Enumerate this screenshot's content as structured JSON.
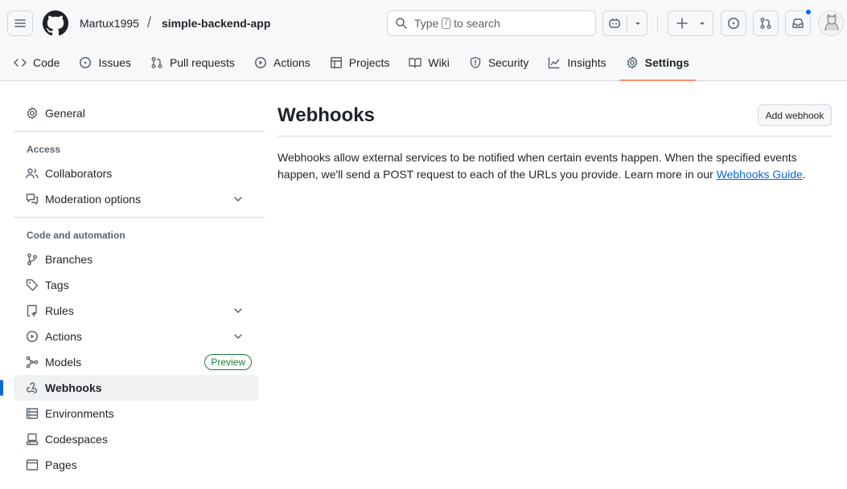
{
  "header": {
    "owner": "Martux1995",
    "separator": "/",
    "repo": "simple-backend-app",
    "search": {
      "prefix": "Type",
      "key": "/",
      "suffix": "to search"
    }
  },
  "tabs": [
    {
      "label": "Code",
      "icon": "code-icon"
    },
    {
      "label": "Issues",
      "icon": "issue-icon"
    },
    {
      "label": "Pull requests",
      "icon": "pull-request-icon"
    },
    {
      "label": "Actions",
      "icon": "play-icon"
    },
    {
      "label": "Projects",
      "icon": "table-icon"
    },
    {
      "label": "Wiki",
      "icon": "book-icon"
    },
    {
      "label": "Security",
      "icon": "shield-icon"
    },
    {
      "label": "Insights",
      "icon": "graph-icon"
    },
    {
      "label": "Settings",
      "icon": "gear-icon",
      "active": true
    }
  ],
  "sidebar": {
    "general": "General",
    "access_heading": "Access",
    "collaborators": "Collaborators",
    "moderation": "Moderation options",
    "code_heading": "Code and automation",
    "branches": "Branches",
    "tags": "Tags",
    "rules": "Rules",
    "actions": "Actions",
    "models": "Models",
    "models_badge": "Preview",
    "webhooks": "Webhooks",
    "environments": "Environments",
    "codespaces": "Codespaces",
    "pages": "Pages"
  },
  "main": {
    "title": "Webhooks",
    "add_button": "Add webhook",
    "description": "Webhooks allow external services to be notified when certain events happen. When the specified events happen, we'll send a POST request to each of the URLs you provide. Learn more in our ",
    "link_text": "Webhooks Guide",
    "description_end": "."
  },
  "colors": {
    "accent": "#0969da",
    "active_underline": "#fd8c73",
    "preview_badge": "#1a7f37",
    "notification_dot": "#0969da"
  }
}
